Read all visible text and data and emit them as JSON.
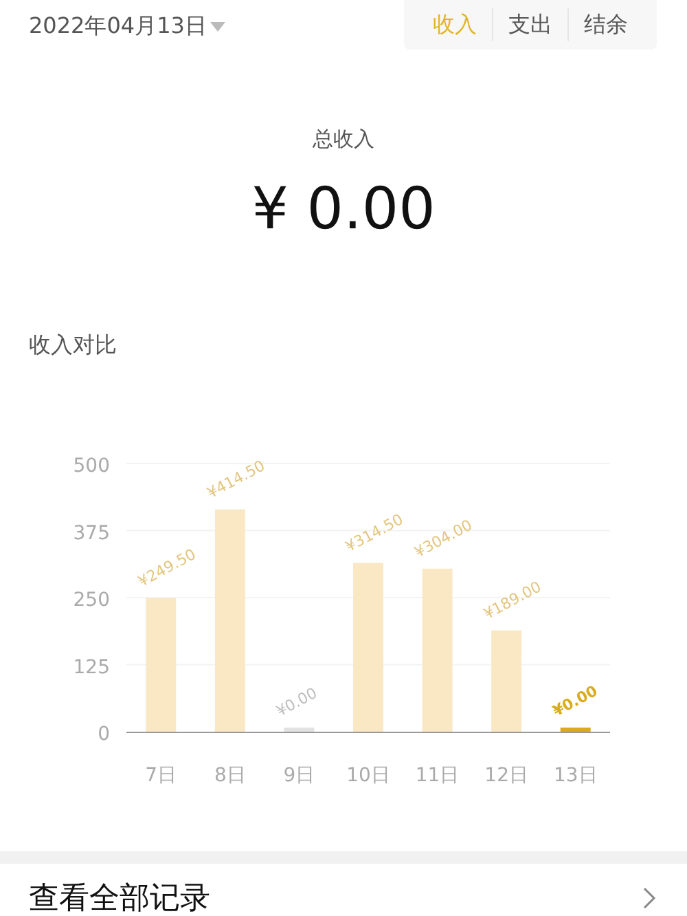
{
  "header": {
    "date": "2022年04月13日",
    "tabs": [
      {
        "label": "收入",
        "selected": true
      },
      {
        "label": "支出",
        "selected": false
      },
      {
        "label": "结余",
        "selected": false
      }
    ]
  },
  "summary": {
    "label": "总收入",
    "amount": "¥ 0.00"
  },
  "comparison": {
    "title": "收入对比",
    "chart_data": {
      "type": "bar",
      "categories": [
        "7日",
        "8日",
        "9日",
        "10日",
        "11日",
        "12日",
        "13日"
      ],
      "values": [
        249.5,
        414.5,
        0,
        314.5,
        304,
        189,
        0
      ],
      "grid": true,
      "ylim": [
        0,
        500
      ],
      "yticks": [
        0,
        125,
        250,
        375,
        500
      ],
      "value_labels": [
        "¥249.50",
        "¥414.50",
        "¥0.00",
        "¥314.50",
        "¥304.00",
        "¥189.00",
        "¥0.00"
      ]
    }
  },
  "footer": {
    "link": "查看全部记录"
  }
}
